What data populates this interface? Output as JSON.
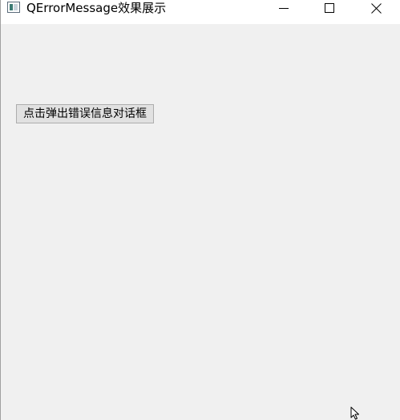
{
  "window": {
    "title": "QErrorMessage效果展示",
    "icon": "qt-app-window-icon",
    "controls": {
      "minimize_icon": "minimize-icon",
      "maximize_icon": "maximize-icon",
      "close_icon": "close-icon"
    }
  },
  "main": {
    "show_error_button_label": "点击弹出错误信息对话框"
  },
  "colors": {
    "titlebar_bg": "#ffffff",
    "client_bg": "#f0f0f0",
    "button_bg": "#e1e1e1",
    "button_border": "#adadad"
  }
}
